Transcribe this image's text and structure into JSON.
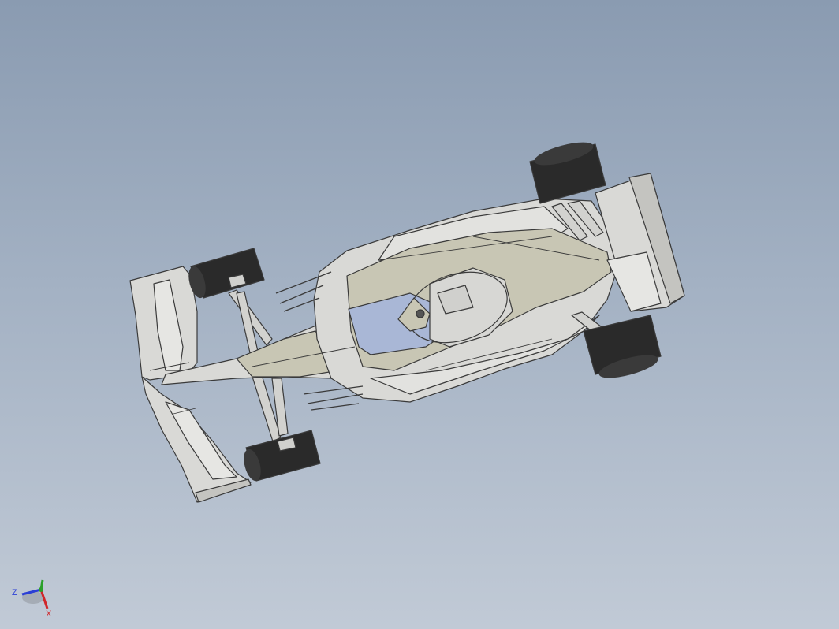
{
  "viewport": {
    "background_top": "#8a9bb1",
    "background_bottom": "#c1cad6"
  },
  "model": {
    "body_color": "#d9d9d6",
    "floor_color": "#c8c6b4",
    "tire_color": "#2a2a2a",
    "edge_color": "#3a3a3a",
    "accent_color": "#a9b7d6"
  },
  "triad": {
    "z_label": "Z",
    "x_label": "X",
    "z_color": "#2b3fd6",
    "x_color": "#d0262a",
    "y_color": "#2aa02a"
  }
}
